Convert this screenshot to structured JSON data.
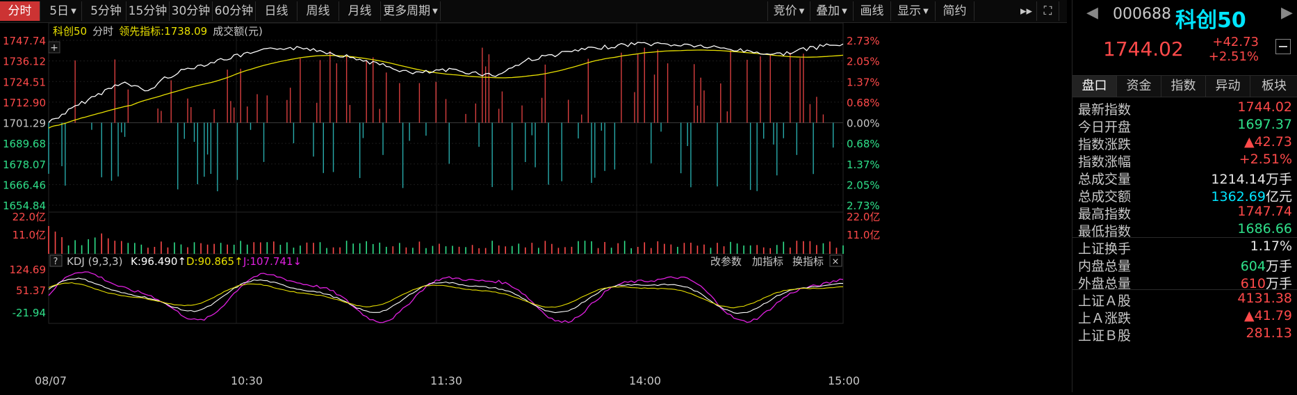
{
  "toolbar": {
    "left": [
      "分时",
      "5日",
      "5分钟",
      "15分钟",
      "30分钟",
      "60分钟",
      "日线",
      "周线",
      "月线",
      "更多周期"
    ],
    "right": [
      "竞价",
      "叠加",
      "画线",
      "显示",
      "简约"
    ],
    "nav_icon": "double-right-arrow-icon",
    "expand_icon": "expand-icon"
  },
  "chart": {
    "legend": {
      "name": "科创50",
      "mode": "分时",
      "lead_label": "领先指标:1738.09",
      "volume_label": "成交额(元)"
    },
    "price_ticks": [
      "1747.74",
      "1736.12",
      "1724.51",
      "1712.90",
      "1701.29",
      "1689.68",
      "1678.07",
      "1666.46",
      "1654.84"
    ],
    "pct_ticks": [
      "2.73%",
      "2.05%",
      "1.37%",
      "0.68%",
      "0.00%",
      "0.68%",
      "1.37%",
      "2.05%",
      "2.73%"
    ],
    "vol_ticks": [
      "22.0亿",
      "11.0亿"
    ],
    "kdj_label": "KDJ (9,3,3)",
    "kdj_k": "K:96.490↑",
    "kdj_d": "D:90.865↑",
    "kdj_j": "J:107.741↓",
    "kdj_ticks": [
      "124.69",
      "51.37",
      "-21.94"
    ],
    "kdj_actions": [
      "改参数",
      "加指标",
      "换指标"
    ],
    "time_ticks": [
      "08/07",
      "10:30",
      "11:30",
      "14:00",
      "15:00"
    ],
    "colors": {
      "up": "#ff4a4a",
      "down": "#2fc9c9",
      "price_line": "#ffffff",
      "avg_line": "#e8e000",
      "j_line": "#e020e0"
    }
  },
  "panel": {
    "code": "000688",
    "name": "科创50",
    "price": "1744.02",
    "change": "+42.73",
    "change_pct": "+2.51%",
    "tabs": [
      "盘口",
      "资金",
      "指数",
      "异动",
      "板块"
    ],
    "rows": [
      {
        "label": "最新指数",
        "value": "1744.02",
        "color": "red"
      },
      {
        "label": "今日开盘",
        "value": "1697.37",
        "color": "green"
      },
      {
        "label": "指数涨跌",
        "value": "▲42.73",
        "color": "red"
      },
      {
        "label": "指数涨幅",
        "value": "+2.51%",
        "color": "red"
      },
      {
        "label": "总成交量",
        "value": "1214.14",
        "unit": "万手",
        "color": "white"
      },
      {
        "label": "总成交额",
        "value": "1362.69",
        "unit": "亿元",
        "color": "cyan"
      },
      {
        "label": "最高指数",
        "value": "1747.74",
        "color": "red"
      },
      {
        "label": "最低指数",
        "value": "1686.66",
        "color": "green"
      },
      {
        "label": "上证换手",
        "value": "1.17%",
        "color": "white"
      },
      {
        "label": "内盘总量",
        "value": "604",
        "unit": "万手",
        "color": "green"
      },
      {
        "label": "外盘总量",
        "value": "610",
        "unit": "万手",
        "color": "red"
      },
      {
        "label": "上证Ａ股",
        "value": "4131.38",
        "color": "red"
      },
      {
        "label": "上Ａ涨跌",
        "value": "▲41.79",
        "color": "red"
      },
      {
        "label": "上证Ｂ股",
        "value": "281.13",
        "color": "red"
      }
    ]
  }
}
